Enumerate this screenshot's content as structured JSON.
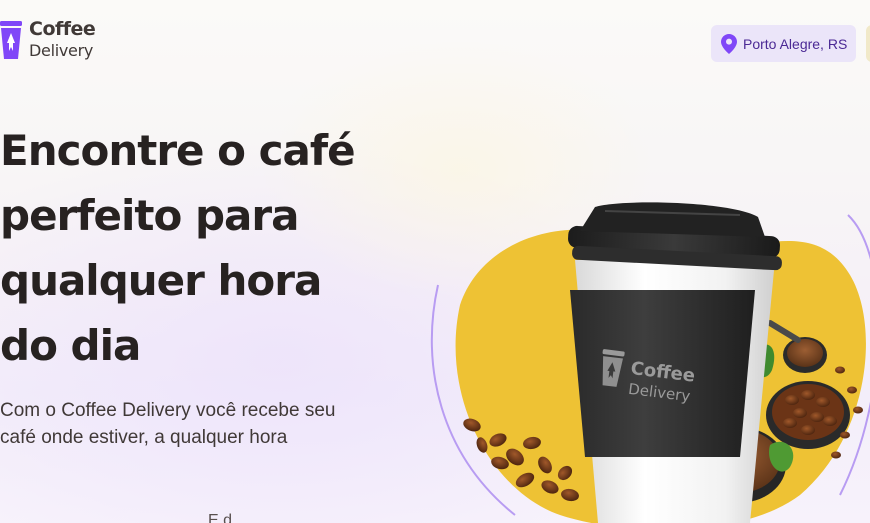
{
  "header": {
    "logo": {
      "line1": "Coffee",
      "line2": "Delivery"
    },
    "location": {
      "label": "Porto Alegre, RS"
    }
  },
  "hero": {
    "title": "Encontre o café perfeito para qualquer hora do dia",
    "subtitle": "Com o Coffee Delivery você recebe seu café onde estiver, a qualquer hora",
    "cup_brand": {
      "line1": "Coffee",
      "line2": "Delivery"
    }
  },
  "next_section": {
    "peek_text": "E d"
  },
  "colors": {
    "purple": "#8047f8",
    "purple_dark": "#4b2995",
    "purple_light": "#ebe5f9",
    "yellow": "#f1c232",
    "text_title": "#272221",
    "text_body": "#403937"
  },
  "icons": {
    "logo": "coffee-cup-rocket-icon",
    "location": "map-pin-icon"
  }
}
